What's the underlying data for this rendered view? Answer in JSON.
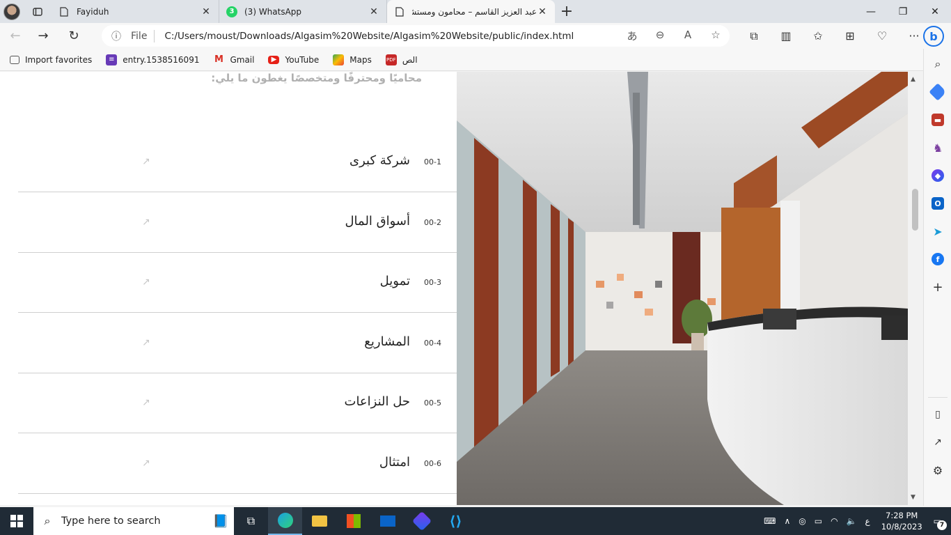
{
  "browser": {
    "tabs": [
      {
        "title": "Fayiduh",
        "icon": "page-icon",
        "active": false
      },
      {
        "title": "(3) WhatsApp",
        "icon": "whatsapp-icon",
        "badge": "3",
        "active": false
      },
      {
        "title": "عبد العزيز القاسم – محامون ومستشار",
        "icon": "page-icon",
        "active": true
      }
    ],
    "address": {
      "scheme_label": "File",
      "url": "C:/Users/moust/Downloads/Algasim%20Website/Algasim%20Website/public/index.html"
    },
    "favorites": [
      {
        "label": "Import favorites",
        "icon": "import-icon"
      },
      {
        "label": "entry.1538516091",
        "icon": "form-icon"
      },
      {
        "label": "Gmail",
        "icon": "gmail-icon"
      },
      {
        "label": "YouTube",
        "icon": "youtube-icon"
      },
      {
        "label": "Maps",
        "icon": "maps-icon"
      },
      {
        "label": "الص",
        "icon": "pdf-icon"
      }
    ]
  },
  "page": {
    "intro_text": "محاميًا ومحترفًا ومتخصصًا يغطون ما يلي:",
    "services": [
      {
        "num": "00-1",
        "title": "شركة كبرى"
      },
      {
        "num": "00-2",
        "title": "أسواق المال"
      },
      {
        "num": "00-3",
        "title": "تمويل"
      },
      {
        "num": "00-4",
        "title": "المشاريع"
      },
      {
        "num": "00-5",
        "title": "حل النزاعات"
      },
      {
        "num": "00-6",
        "title": "امتثال"
      }
    ]
  },
  "taskbar": {
    "search_placeholder": "Type here to search",
    "time": "7:28 PM",
    "date": "10/8/2023",
    "lang": "ع",
    "notifications": "7"
  }
}
